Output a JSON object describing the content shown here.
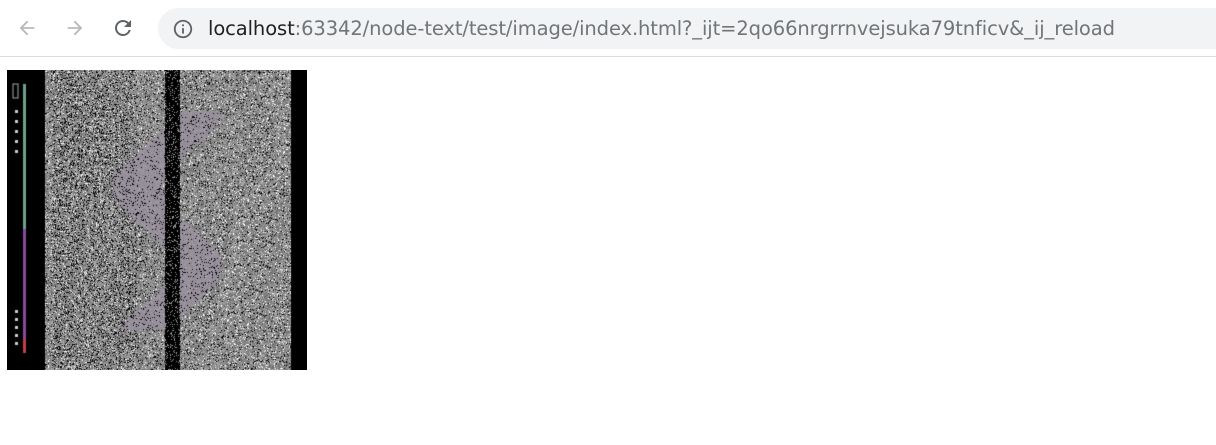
{
  "browser": {
    "back_icon": "arrow-left-icon",
    "forward_icon": "arrow-right-icon",
    "reload_icon": "reload-icon",
    "info_icon": "info-circle-icon",
    "url_host": "localhost",
    "url_rest": ":63342/node-text/test/image/index.html?_ijt=2qo66nrgrrnvejsuka79tnficv&_ij_reload"
  },
  "page": {
    "image_name": "noise-image",
    "colors": {
      "noise_background": "#7a7a7a",
      "side_bar_left": "#000000",
      "center_stripe": "#000000",
      "gauge_green": "#6fa08a",
      "gauge_purple": "#8a4a9a",
      "gauge_red": "#c04040"
    }
  }
}
